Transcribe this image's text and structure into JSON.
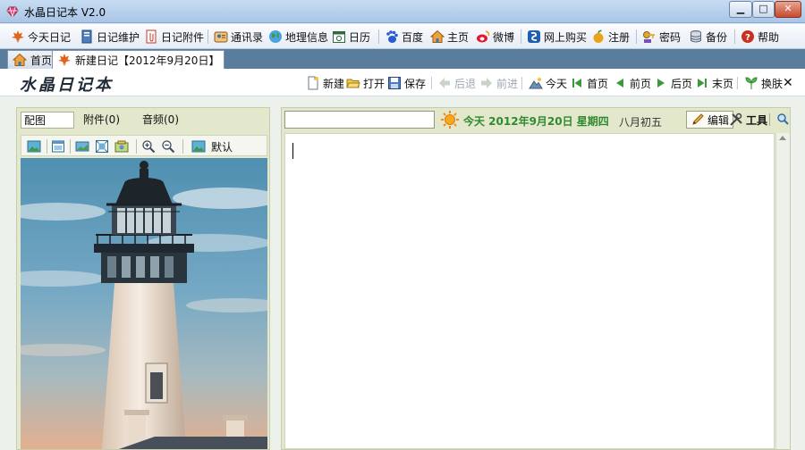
{
  "window": {
    "title": "水晶日记本 V2.0",
    "min_glyph": "▁",
    "max_glyph": "□",
    "close_glyph": "✕"
  },
  "toolbar": {
    "items": [
      {
        "label": "今天日记",
        "icon": "maple-leaf-icon"
      },
      {
        "label": "日记维护",
        "icon": "notebook-icon"
      },
      {
        "label": "日记附件",
        "icon": "attachment-icon"
      },
      {
        "label": "通讯录",
        "icon": "contacts-icon"
      },
      {
        "label": "地理信息",
        "icon": "globe-icon"
      },
      {
        "label": "日历",
        "icon": "calendar-icon"
      },
      {
        "label": "百度",
        "icon": "baidu-paw-icon"
      },
      {
        "label": "主页",
        "icon": "home-icon"
      },
      {
        "label": "微博",
        "icon": "weibo-icon"
      },
      {
        "label": "网上购买",
        "icon": "shop-icon"
      },
      {
        "label": "注册",
        "icon": "register-apple-icon"
      },
      {
        "label": "密码",
        "icon": "key-icon"
      },
      {
        "label": "备份",
        "icon": "database-icon"
      },
      {
        "label": "帮助",
        "icon": "help-icon"
      }
    ]
  },
  "tabs": [
    {
      "label": "首页",
      "icon": "home-icon"
    },
    {
      "label": "新建日记【2012年9月20日】",
      "icon": "maple-leaf-icon",
      "active": true
    }
  ],
  "header": {
    "logo": "水晶日记本",
    "nav": [
      {
        "label": "新建",
        "icon": "new-doc-icon"
      },
      {
        "label": "打开",
        "icon": "folder-open-icon"
      },
      {
        "label": "保存",
        "icon": "save-icon"
      },
      {
        "label": "后退",
        "icon": "back-arrow-icon",
        "disabled": true
      },
      {
        "label": "前进",
        "icon": "forward-arrow-icon",
        "disabled": true
      },
      {
        "label": "今天",
        "icon": "mountain-icon"
      },
      {
        "label": "首页",
        "icon": "first-page-icon"
      },
      {
        "label": "前页",
        "icon": "prev-page-icon"
      },
      {
        "label": "后页",
        "icon": "next-page-icon"
      },
      {
        "label": "末页",
        "icon": "last-page-icon"
      },
      {
        "label": "换肤",
        "icon": "skin-leaf-icon"
      }
    ],
    "close_glyph": "✕"
  },
  "left_panel": {
    "tabs": [
      "配图",
      "附件(0)",
      "音频(0)"
    ],
    "image_tools_default": "默认"
  },
  "right_panel": {
    "title_value": "",
    "date": "今天 2012年9月20日 星期四",
    "lunar": "八月初五",
    "edit_label": "编辑",
    "tools_label": "工具"
  },
  "colors": {
    "accent_green": "#2f8a2f",
    "tab_bar": "#5a7d9e",
    "panel": "#e3e8cc"
  }
}
